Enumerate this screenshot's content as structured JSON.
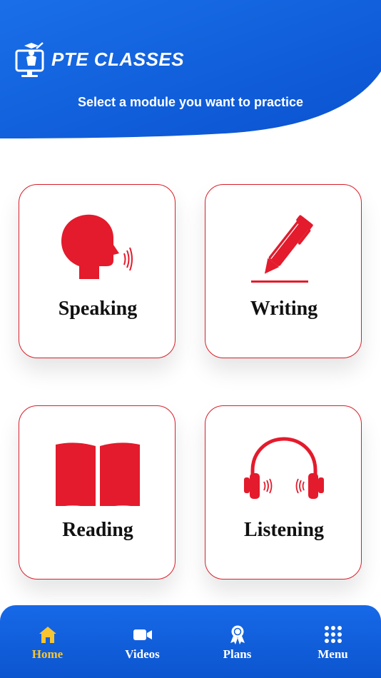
{
  "header": {
    "brand": "PTE CLASSES",
    "subtitle": "Select a module you want to practice"
  },
  "modules": [
    {
      "label": "Speaking",
      "icon": "speaking-head-icon"
    },
    {
      "label": "Writing",
      "icon": "pen-icon"
    },
    {
      "label": "Reading",
      "icon": "open-book-icon"
    },
    {
      "label": "Listening",
      "icon": "headphones-icon"
    }
  ],
  "nav": {
    "items": [
      {
        "label": "Home",
        "icon": "home-icon",
        "active": true
      },
      {
        "label": "Videos",
        "icon": "video-camera-icon",
        "active": false
      },
      {
        "label": "Plans",
        "icon": "award-badge-icon",
        "active": false
      },
      {
        "label": "Menu",
        "icon": "grid-menu-icon",
        "active": false
      }
    ]
  },
  "colors": {
    "primary_blue": "#0c5fdc",
    "accent_red": "#e31b2c",
    "active_nav": "#f6c531"
  }
}
